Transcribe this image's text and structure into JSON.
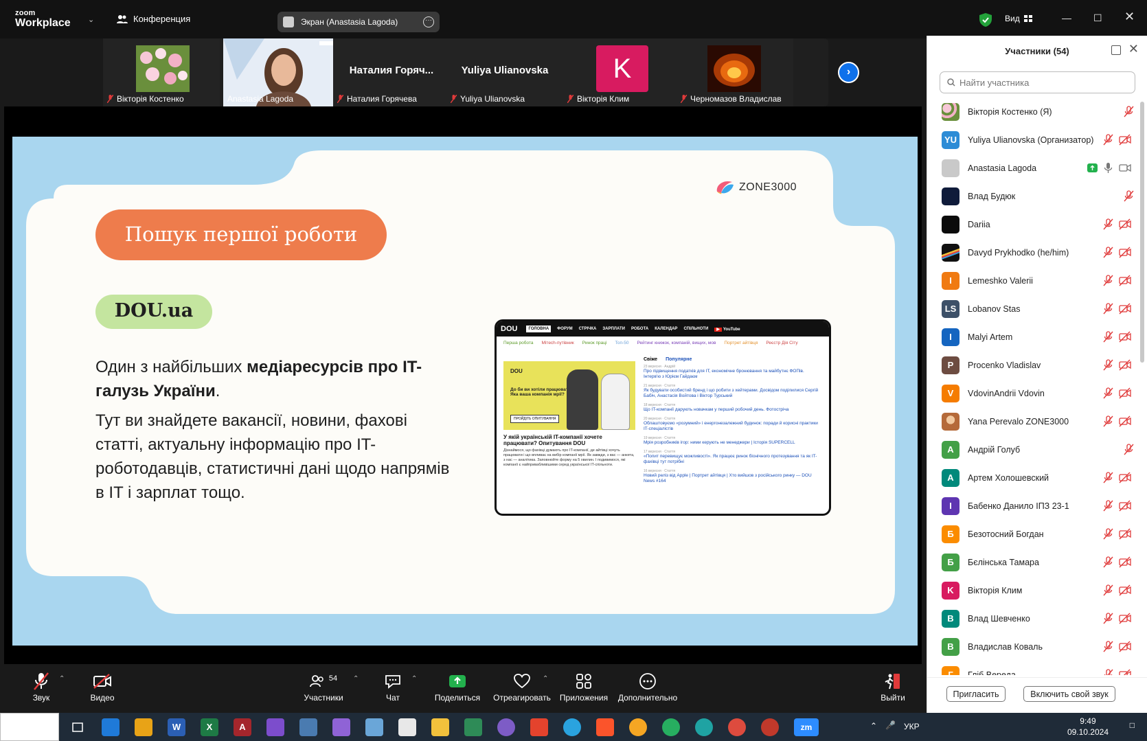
{
  "app": {
    "logo_line1": "zoom",
    "logo_line2": "Workplace",
    "meeting_label": "Конференция",
    "share_label": "Экран (Anastasia Lagoda)",
    "view_label": "Вид"
  },
  "thumbnails": [
    {
      "name": "Вікторія Костенко",
      "type": "flowers"
    },
    {
      "name": "Anastasia Lagoda",
      "type": "camera",
      "active": true
    },
    {
      "name": "Наталия Горячева",
      "display": "Наталия  Горяч..."
    },
    {
      "name": "Yuliya Ulianovska",
      "display": "Yuliya Ulianovska"
    },
    {
      "name": "Вікторія Клим",
      "type": "letter",
      "letter": "K",
      "color": "#d81b60"
    },
    {
      "name": "Черномазов Владислав",
      "type": "fire"
    }
  ],
  "slide": {
    "brand": "ZONE3000",
    "title_pill": "Пошук першої роботи",
    "site_pill": "DOU.ua",
    "para1_a": "Один з найбільших ",
    "para1_b": "медіаресурсів про IT-галузь України",
    "para1_c": ".",
    "para2": "Тут ви знайдете вакансії, новини, фахові статті, актуальну інформацію про IT-роботодавців, статистичні дані щодо напрямів в IT і зарплат тощо.",
    "dou": {
      "brand": "DOU",
      "nav": [
        "ГОЛОВНА",
        "ФОРУМ",
        "СТРІЧКА",
        "ЗАРПЛАТИ",
        "РОБОТА",
        "КАЛЕНДАР",
        "СПІЛЬНОТИ",
        "YouTube"
      ],
      "tags": [
        "Перша робота",
        "Мітech-путівник",
        "Ринок праці",
        "Топ-50",
        "Рейтинг книжок, компаній, вищих, мов",
        "Портрет айтівця",
        "Реєстр Дія Сіту"
      ],
      "tabs": [
        "Свіже",
        "Популярне"
      ],
      "hero_label": "DOU",
      "hero_question": "До би ви хотіли працювати? Яка ваша компанія мрії?",
      "hero_button": "ПРОЙДІТЬ ОПИТУВАННЯ",
      "hero_title": "У якій українській IT-компанії хочете працювати? Опитування DOU",
      "hero_text": "Дізнаймося, що фахівці думають про IT-компанії, де айтівці хочуть працювати і що впливає на вибір компанії мрії. Як завжди, з вас — анкета, з нас — аналітика. Заповнюйте форму на 5 хвилин. І подивимося, які компанії є найпривабливішими серед української IT-спільноти.",
      "news": [
        {
          "meta": "23 вересня · Андрій",
          "text": "Про підвищення податків для IT, економічне бронювання та майбутнє ФОПів. Інтерв'ю з Юрієм Гайдаєм"
        },
        {
          "meta": "21 вересня · Стаття",
          "text": "Як будувати особистий бренд і що робити з хейтерами. Досвідом поділилися Сергій Бабіч, Анастасія Войтова і Віктор Турський"
        },
        {
          "meta": "18 вересня · Стаття",
          "text": "Що IT-компанії дарують новачкам у перший робочий день. Фотостріча"
        },
        {
          "meta": "20 вересня · Стаття",
          "text": "Облаштовуємо «розумний» і енергонезалежний будинок: поради й корисні практики IT-спеціалістів"
        },
        {
          "meta": "19 вересня · Стаття",
          "text": "Мрія розробників ігор: ними керують не менеджери | Історія SUPERCELL"
        },
        {
          "meta": "17 вересня · Стаття",
          "text": "«Попит перевищує можливості». Як працює ринок біонічного протезування та як IT-фахівці тут потрібні"
        },
        {
          "meta": "16 вересня · Стаття",
          "text": "Новий реліз від Apple | Портрет айтівця | Хто вийшов з російського ринку — DOU News #164"
        }
      ]
    }
  },
  "panel": {
    "title": "Участники (54)",
    "search_placeholder": "Найти участника",
    "participants": [
      {
        "name": "Вікторія Костенко (Я)",
        "avatar_type": "flowers",
        "mic": "off",
        "cam": "none"
      },
      {
        "name": "Yuliya Ulianovska (Организатор)",
        "initials": "YU",
        "color": "#2d8cd6",
        "mic": "off",
        "cam": "off"
      },
      {
        "name": "Anastasia Lagoda",
        "color": "#c9c9c9",
        "mic": "on",
        "cam": "on",
        "sharing": true
      },
      {
        "name": "Влад Будюк",
        "color": "#0f1b3a",
        "mic": "off",
        "cam": "none"
      },
      {
        "name": "Dariia",
        "color": "#0b0b0b",
        "mic": "off",
        "cam": "off"
      },
      {
        "name": "Davyd Prykhodko (he/him)",
        "avatar_type": "prism",
        "color": "#111111",
        "mic": "off",
        "cam": "off"
      },
      {
        "name": "Lemeshko Valerii",
        "initials": "I",
        "color": "#f07a12",
        "mic": "off",
        "cam": "off"
      },
      {
        "name": "Lobanov Stas",
        "initials": "LS",
        "color": "#3d5068",
        "mic": "off",
        "cam": "off"
      },
      {
        "name": "Malyi Artem",
        "initials": "I",
        "color": "#1565c0",
        "mic": "off",
        "cam": "off"
      },
      {
        "name": "Procenko Vladislav",
        "initials": "P",
        "color": "#6d4c41",
        "mic": "off",
        "cam": "off"
      },
      {
        "name": "VdovinAndrii Vdovin",
        "initials": "V",
        "color": "#f57c00",
        "mic": "off",
        "cam": "off"
      },
      {
        "name": "Yana Perevalo ZONE3000",
        "avatar_type": "photo",
        "color": "#c98a5a",
        "mic": "off",
        "cam": "off"
      },
      {
        "name": "Андрій Голуб",
        "initials": "A",
        "color": "#43a047",
        "mic": "off",
        "cam": "none"
      },
      {
        "name": "Артем Холошевский",
        "initials": "A",
        "color": "#00897b",
        "mic": "off",
        "cam": "off"
      },
      {
        "name": "Бабенко Данило ІПЗ 23-1",
        "initials": "I",
        "color": "#5e35b1",
        "mic": "off",
        "cam": "off"
      },
      {
        "name": "Безотосний Богдан",
        "initials": "Б",
        "color": "#fb8c00",
        "mic": "off",
        "cam": "off"
      },
      {
        "name": "Бєлінська Тамара",
        "initials": "Б",
        "color": "#43a047",
        "mic": "off",
        "cam": "off"
      },
      {
        "name": "Вікторія Клим",
        "initials": "K",
        "color": "#d81b60",
        "mic": "off",
        "cam": "off"
      },
      {
        "name": "Влад Шевченко",
        "initials": "B",
        "color": "#00897b",
        "mic": "off",
        "cam": "off"
      },
      {
        "name": "Владислав Коваль",
        "initials": "B",
        "color": "#43a047",
        "mic": "off",
        "cam": "off"
      },
      {
        "name": "Гліб Вереда",
        "initials": "Г",
        "color": "#fb8c00",
        "mic": "off",
        "cam": "off"
      }
    ],
    "invite_label": "Пригласить",
    "unmute_label": "Включить свой звук"
  },
  "toolbar": {
    "audio": "Звук",
    "video": "Видео",
    "participants": "Участники",
    "participants_count": "54",
    "chat": "Чат",
    "share": "Поделиться",
    "react": "Отреагировать",
    "apps": "Приложения",
    "more": "Дополнительно",
    "leave": "Выйти"
  },
  "taskbar": {
    "lang": "УКР",
    "time": "9:49",
    "date": "09.10.2024"
  }
}
